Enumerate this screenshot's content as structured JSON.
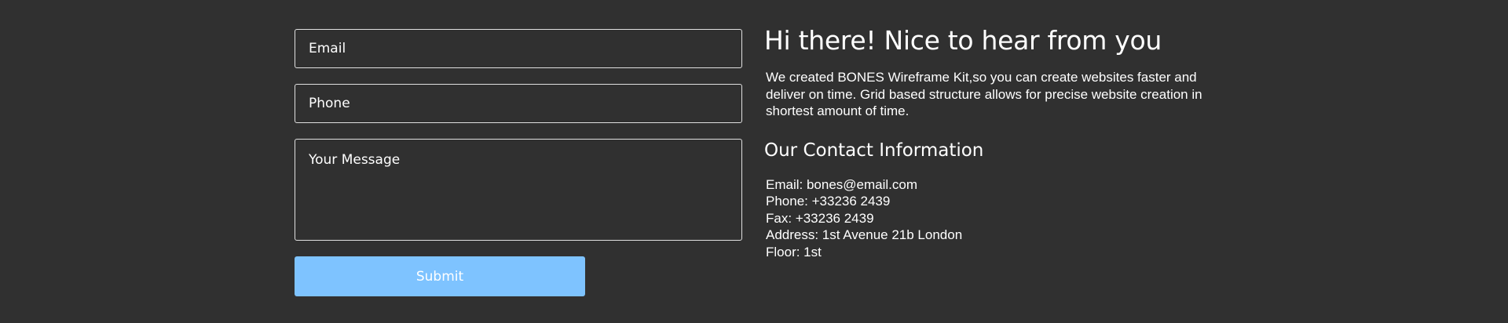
{
  "form": {
    "email_placeholder": "Email",
    "phone_placeholder": "Phone",
    "message_placeholder": "Your Message",
    "submit_label": "Submit"
  },
  "info": {
    "headline": "Hi there! Nice to hear from you",
    "intro": "We created BONES Wireframe Kit,so you can create websites faster and deliver on time. Grid based structure allows for precise website creation in shortest amount of time.",
    "contact_heading": "Our Contact Information",
    "contact_items": [
      "Email: bones@email.com",
      "Phone: +33236 2439",
      "Fax: +33236 2439",
      "Address: 1st Avenue 21b London",
      "Floor: 1st"
    ]
  },
  "colors": {
    "background": "#303030",
    "text": "#ffffff",
    "field_border": "#e0e0e0",
    "submit_background": "#7ec3ff"
  }
}
